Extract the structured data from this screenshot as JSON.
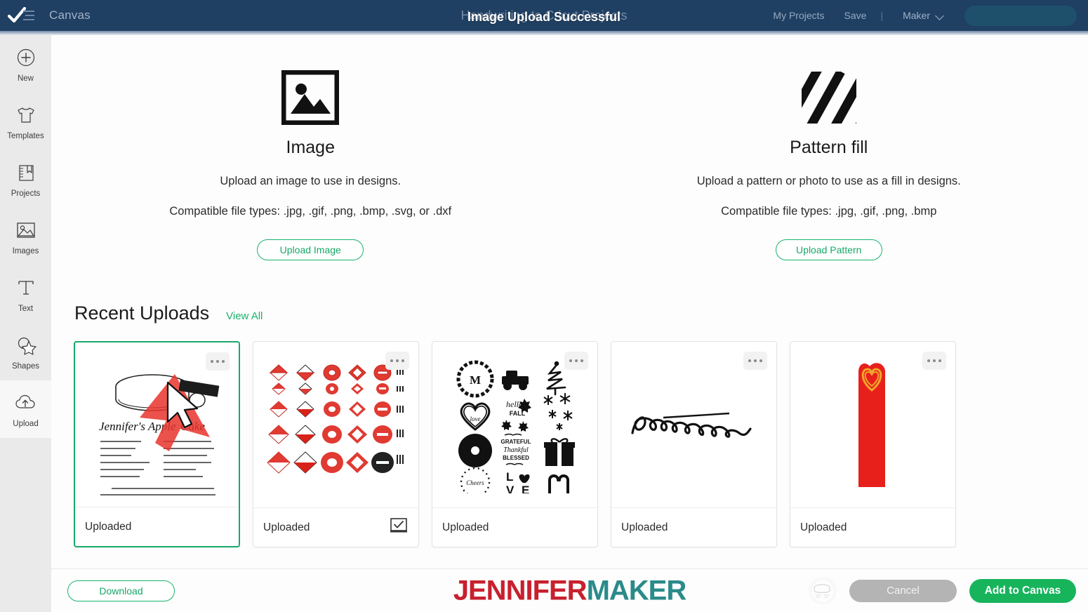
{
  "header": {
    "logo_icon": "checkmark-menu-logo",
    "canvas_label": "Canvas",
    "project_title": "Handwriting to Cricut Projects",
    "toast_message": "Image Upload Successful",
    "my_projects_label": "My Projects",
    "save_label": "Save",
    "separator": "|",
    "machine_label": "Maker",
    "machine_chevron_icon": "chevron-down-icon",
    "cta_label": "",
    "bg_color": "#1f3f63"
  },
  "sidebar": {
    "items": [
      {
        "label": "New",
        "icon": "plus-circle-icon",
        "active": false
      },
      {
        "label": "Templates",
        "icon": "tshirt-icon",
        "active": false
      },
      {
        "label": "Projects",
        "icon": "book-bookmark-icon",
        "active": false
      },
      {
        "label": "Images",
        "icon": "picture-icon",
        "active": false
      },
      {
        "label": "Text",
        "icon": "text-t-icon",
        "active": false
      },
      {
        "label": "Shapes",
        "icon": "shapes-star-icon",
        "active": false
      },
      {
        "label": "Upload",
        "icon": "cloud-upload-icon",
        "active": true
      }
    ]
  },
  "upload_panel": {
    "image": {
      "icon": "image-placeholder-icon",
      "title": "Image",
      "description": "Upload an image to use in designs.",
      "file_types": "Compatible file types: .jpg, .gif, .png, .bmp, .svg, or .dxf",
      "button_label": "Upload Image"
    },
    "pattern": {
      "icon": "diagonal-stripes-icon",
      "title": "Pattern fill",
      "description": "Upload a pattern or photo to use as a fill in designs.",
      "file_types": "Compatible file types: .jpg, .gif, .png, .bmp",
      "button_label": "Upload Pattern"
    }
  },
  "recent_uploads": {
    "title": "Recent Uploads",
    "view_all_label": "View All",
    "cards": [
      {
        "artwork": "handwritten-recipe-apple-cake",
        "artwork_title": "Jennifer's Apple Miso Cake",
        "status": "Uploaded",
        "selected": true,
        "menu_icon": "more-options-icon",
        "print_then_cut": false,
        "has_cursor_overlay": true
      },
      {
        "artwork": "red-ornament-grid",
        "status": "Uploaded",
        "selected": false,
        "menu_icon": "more-options-icon",
        "print_then_cut": true,
        "print_then_cut_icon": "print-then-cut-icon"
      },
      {
        "artwork": "black-svg-icon-grid",
        "status": "Uploaded",
        "selected": false,
        "menu_icon": "more-options-icon",
        "print_then_cut": false
      },
      {
        "artwork": "love-mother-signature",
        "artwork_title": "Love, mother",
        "status": "Uploaded",
        "selected": false,
        "menu_icon": "more-options-icon",
        "print_then_cut": false
      },
      {
        "artwork": "red-heart-bookmark",
        "status": "Uploaded",
        "selected": false,
        "menu_icon": "more-options-icon",
        "print_then_cut": false
      }
    ]
  },
  "bottom_bar": {
    "download_label": "Download",
    "watermark_part1": "JENNIFER",
    "watermark_part2": "MAKER",
    "selected_thumb_icon": "selected-image-thumbnail",
    "cancel_label": "Cancel",
    "add_to_canvas_label": "Add to Canvas"
  },
  "colors": {
    "header_navy": "#1f3f63",
    "accent_green": "#19b36b",
    "primary_green": "#17b45c",
    "cancel_gray": "#b4b4b4",
    "watermark_red": "#c8202e",
    "watermark_teal": "#2b8a8a"
  }
}
